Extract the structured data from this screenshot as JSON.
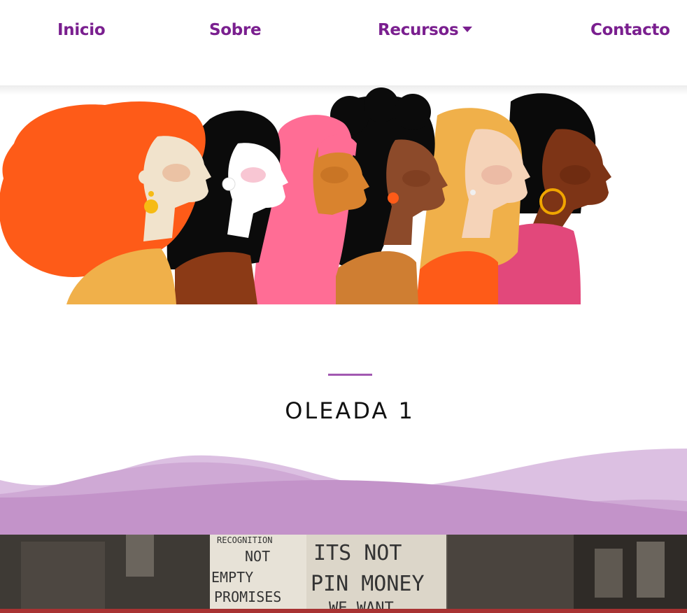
{
  "nav": {
    "items": [
      {
        "label": "Inicio"
      },
      {
        "label": "Sobre"
      },
      {
        "label": "Recursos"
      },
      {
        "label": "Contacto"
      }
    ]
  },
  "section": {
    "title": "OLEADA 1"
  },
  "photo": {
    "sign_left": [
      "RECOGNITION",
      "NOT",
      "EMPTY",
      "PROMISES"
    ],
    "sign_right": [
      "ITS NOT",
      "PIN MONEY",
      "WE WANT"
    ]
  },
  "colors": {
    "brand_purple": "#7a1f8f",
    "divider": "#a259b1",
    "wave_light": "#d8b8de",
    "wave_mid": "#c393c9"
  }
}
